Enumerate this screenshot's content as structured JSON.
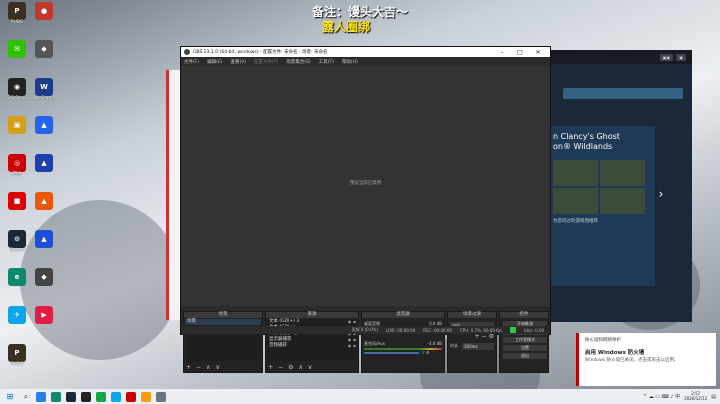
{
  "overlay": {
    "line1": "备注：馒头大吉～",
    "line2": "露人圈绑"
  },
  "desktop_icons": [
    {
      "label": "PUBG",
      "icon": "pubg-icon",
      "color": "#3a2f20",
      "glyph": "P"
    },
    {
      "label": "",
      "icon": "app-icon",
      "color": "#c0392b",
      "glyph": "●"
    },
    {
      "label": "",
      "icon": "wechat-icon",
      "color": "#2dc100",
      "glyph": "✉"
    },
    {
      "label": "",
      "icon": "app-icon",
      "color": "#555",
      "glyph": "◆"
    },
    {
      "label": "OBS Studio",
      "icon": "obs-icon",
      "color": "#222",
      "glyph": "◉"
    },
    {
      "label": "WeGame",
      "icon": "wegame-icon",
      "color": "#1e3a8a",
      "glyph": "W"
    },
    {
      "label": "",
      "icon": "app-icon",
      "color": "#d4a017",
      "glyph": "▣"
    },
    {
      "label": "",
      "icon": "app-icon",
      "color": "#2563eb",
      "glyph": "▲"
    },
    {
      "label": "网易",
      "icon": "netease-icon",
      "color": "#c00",
      "glyph": "◎"
    },
    {
      "label": "",
      "icon": "app-icon",
      "color": "#1e40af",
      "glyph": "▲"
    },
    {
      "label": "",
      "icon": "app-icon",
      "color": "#d00",
      "glyph": "■"
    },
    {
      "label": "",
      "icon": "app-icon",
      "color": "#ea580c",
      "glyph": "▲"
    },
    {
      "label": "Steam",
      "icon": "steam-icon",
      "color": "#1b2838",
      "glyph": "⊙"
    },
    {
      "label": "",
      "icon": "app-icon",
      "color": "#1d4ed8",
      "glyph": "▲"
    },
    {
      "label": "",
      "icon": "edge-icon",
      "color": "#0c8a6b",
      "glyph": "e"
    },
    {
      "label": "",
      "icon": "app-icon",
      "color": "#444",
      "glyph": "◆"
    },
    {
      "label": "",
      "icon": "app-icon",
      "color": "#0ea5e9",
      "glyph": "✈"
    },
    {
      "label": "",
      "icon": "app-icon",
      "color": "#e11d48",
      "glyph": "▶"
    },
    {
      "label": "PUBG",
      "icon": "pubg-icon",
      "color": "#3a2f20",
      "glyph": "P"
    }
  ],
  "steam": {
    "title_line1": "n Clancy's Ghost",
    "title_line2": "on® Wildlands",
    "reason": "为您玩过的游戏而推荐",
    "arrow": "›"
  },
  "obs": {
    "title": "OBS 23.1.0 (64-bit, windows) - 配置文件: 未命名 - 场景: 未命名",
    "menu": [
      {
        "label": "文件(F)",
        "disabled": false
      },
      {
        "label": "编辑(E)",
        "disabled": false
      },
      {
        "label": "查看(V)",
        "disabled": false
      },
      {
        "label": "配置文件(P)",
        "disabled": true
      },
      {
        "label": "场景集合(S)",
        "disabled": false
      },
      {
        "label": "工具(T)",
        "disabled": false
      },
      {
        "label": "帮助(H)",
        "disabled": false
      }
    ],
    "preview_message": "预览当前已禁用",
    "docks": {
      "scenes": {
        "title": "场景",
        "items": [
          "场景"
        ]
      },
      "sources": {
        "title": "来源",
        "items": [
          "文本 (GDI+) 3",
          "文本 (GDI+)",
          "头像动物.png",
          "显示器捕获",
          "音频捕获"
        ]
      },
      "mixer": {
        "title": "混音器",
        "tracks": [
          {
            "name": "桌面音频",
            "db": "0.0 dB"
          },
          {
            "name": "麦克风/Aux",
            "db": "-4.6 dB"
          }
        ]
      },
      "transitions": {
        "title": "场景过渡",
        "type": "淡出",
        "duration_label": "时长",
        "duration": "300ms"
      },
      "controls": {
        "title": "控件",
        "buttons": [
          "开始推流",
          "开始录制",
          "工作室模式",
          "设置",
          "退出"
        ]
      }
    },
    "status": {
      "dropped": "丢帧 0 (0.0%)",
      "live": "LIVE: 00:00:00",
      "rec": "REC: 00:00:00",
      "cpu": "CPU: 0.7%, 60.00 fps",
      "bitrate": "kb/s: 0.00"
    }
  },
  "notification": {
    "app": "防火墙和网络保护",
    "title": "启用 Windows 防火墙",
    "body": "Windows 防火墙已关闭。点击或单击以启用。"
  },
  "taskbar": {
    "start": "⊞",
    "search": "⌕",
    "apps": [
      {
        "icon": "chrome-icon",
        "color": "#2b7de9"
      },
      {
        "icon": "edge-icon",
        "color": "#0c8a6b"
      },
      {
        "icon": "steam-icon",
        "color": "#1b2838"
      },
      {
        "icon": "obs-icon",
        "color": "#222"
      },
      {
        "icon": "app-icon",
        "color": "#16a34a"
      },
      {
        "icon": "app-icon",
        "color": "#0ea5e9"
      },
      {
        "icon": "netease-icon",
        "color": "#c00"
      },
      {
        "icon": "app-icon",
        "color": "#f59e0b"
      },
      {
        "icon": "app-icon",
        "color": "#6b7280"
      }
    ],
    "tray": "^ ☁ ▭ ⌨ ♪ 中",
    "time": "2:57",
    "date": "2020/12/12"
  }
}
